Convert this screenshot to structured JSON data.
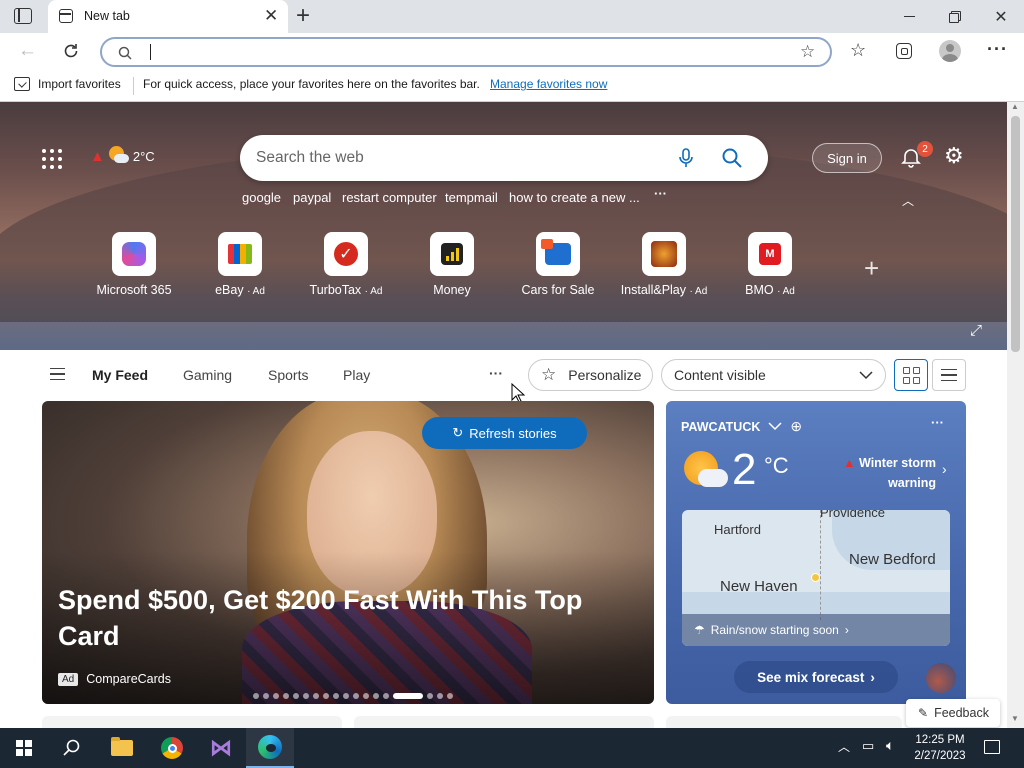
{
  "tab": {
    "title": "New tab"
  },
  "address": {
    "value": "",
    "placeholder": ""
  },
  "favorites_bar": {
    "import_label": "Import favorites",
    "message": "For quick access, place your favorites here on the favorites bar.",
    "manage_link": "Manage favorites now"
  },
  "hero": {
    "temperature": "2°C",
    "search_placeholder": "Search the web",
    "sign_in": "Sign in",
    "notification_count": "2",
    "suggestions": [
      "google",
      "paypal",
      "restart computer",
      "tempmail",
      "how to create a new ..."
    ],
    "more": "···",
    "tiles": [
      {
        "label": "Microsoft 365",
        "ad": ""
      },
      {
        "label": "eBay",
        "ad": "· Ad"
      },
      {
        "label": "TurboTax",
        "ad": "· Ad"
      },
      {
        "label": "Money",
        "ad": ""
      },
      {
        "label": "Cars for Sale",
        "ad": ""
      },
      {
        "label": "Install&Play",
        "ad": "· Ad"
      },
      {
        "label": "BMO",
        "ad": "· Ad"
      }
    ]
  },
  "feed": {
    "tabs": [
      "My Feed",
      "Gaming",
      "Sports",
      "Play"
    ],
    "more": "···",
    "personalize": "Personalize",
    "content_select": "Content visible",
    "refresh": "Refresh stories"
  },
  "story": {
    "headline": "Spend $500, Get $200 Fast With This Top Card",
    "ad_badge": "Ad",
    "source": "CompareCards",
    "dots_total": 18,
    "dots_active_index": 14
  },
  "weather": {
    "location": "PAWCATUCK",
    "more": "···",
    "temp": "2",
    "unit": "°C",
    "alert_line1": "Winter storm",
    "alert_line2": "warning",
    "map_labels": [
      "Hartford",
      "Providence",
      "New Bedford",
      "New Haven"
    ],
    "precip": "Rain/snow starting soon",
    "forecast_button": "See mix forecast"
  },
  "feedback": "Feedback",
  "taskbar": {
    "time": "12:25 PM",
    "date": "2/27/2023"
  }
}
